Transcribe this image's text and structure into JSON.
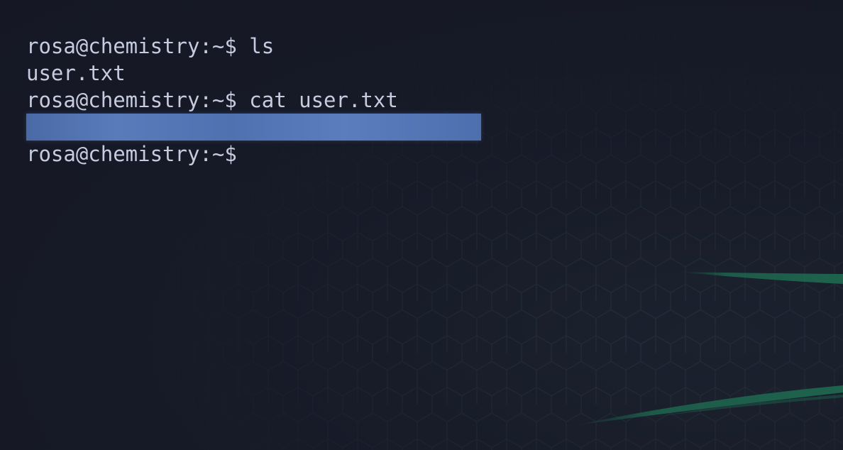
{
  "terminal": {
    "lines": [
      {
        "prompt": "rosa@chemistry:~$",
        "command": " ls"
      },
      {
        "output": "user.txt"
      },
      {
        "prompt": "rosa@chemistry:~$",
        "command": " cat user.txt"
      },
      {
        "redacted": true
      },
      {
        "prompt": "rosa@chemistry:~$",
        "command": ""
      }
    ]
  },
  "colors": {
    "background": "#161826",
    "text": "#c6cbdf",
    "redaction": "#5274b3",
    "hex_grid": "#1f2a33",
    "streak": "#1e5f4a"
  }
}
